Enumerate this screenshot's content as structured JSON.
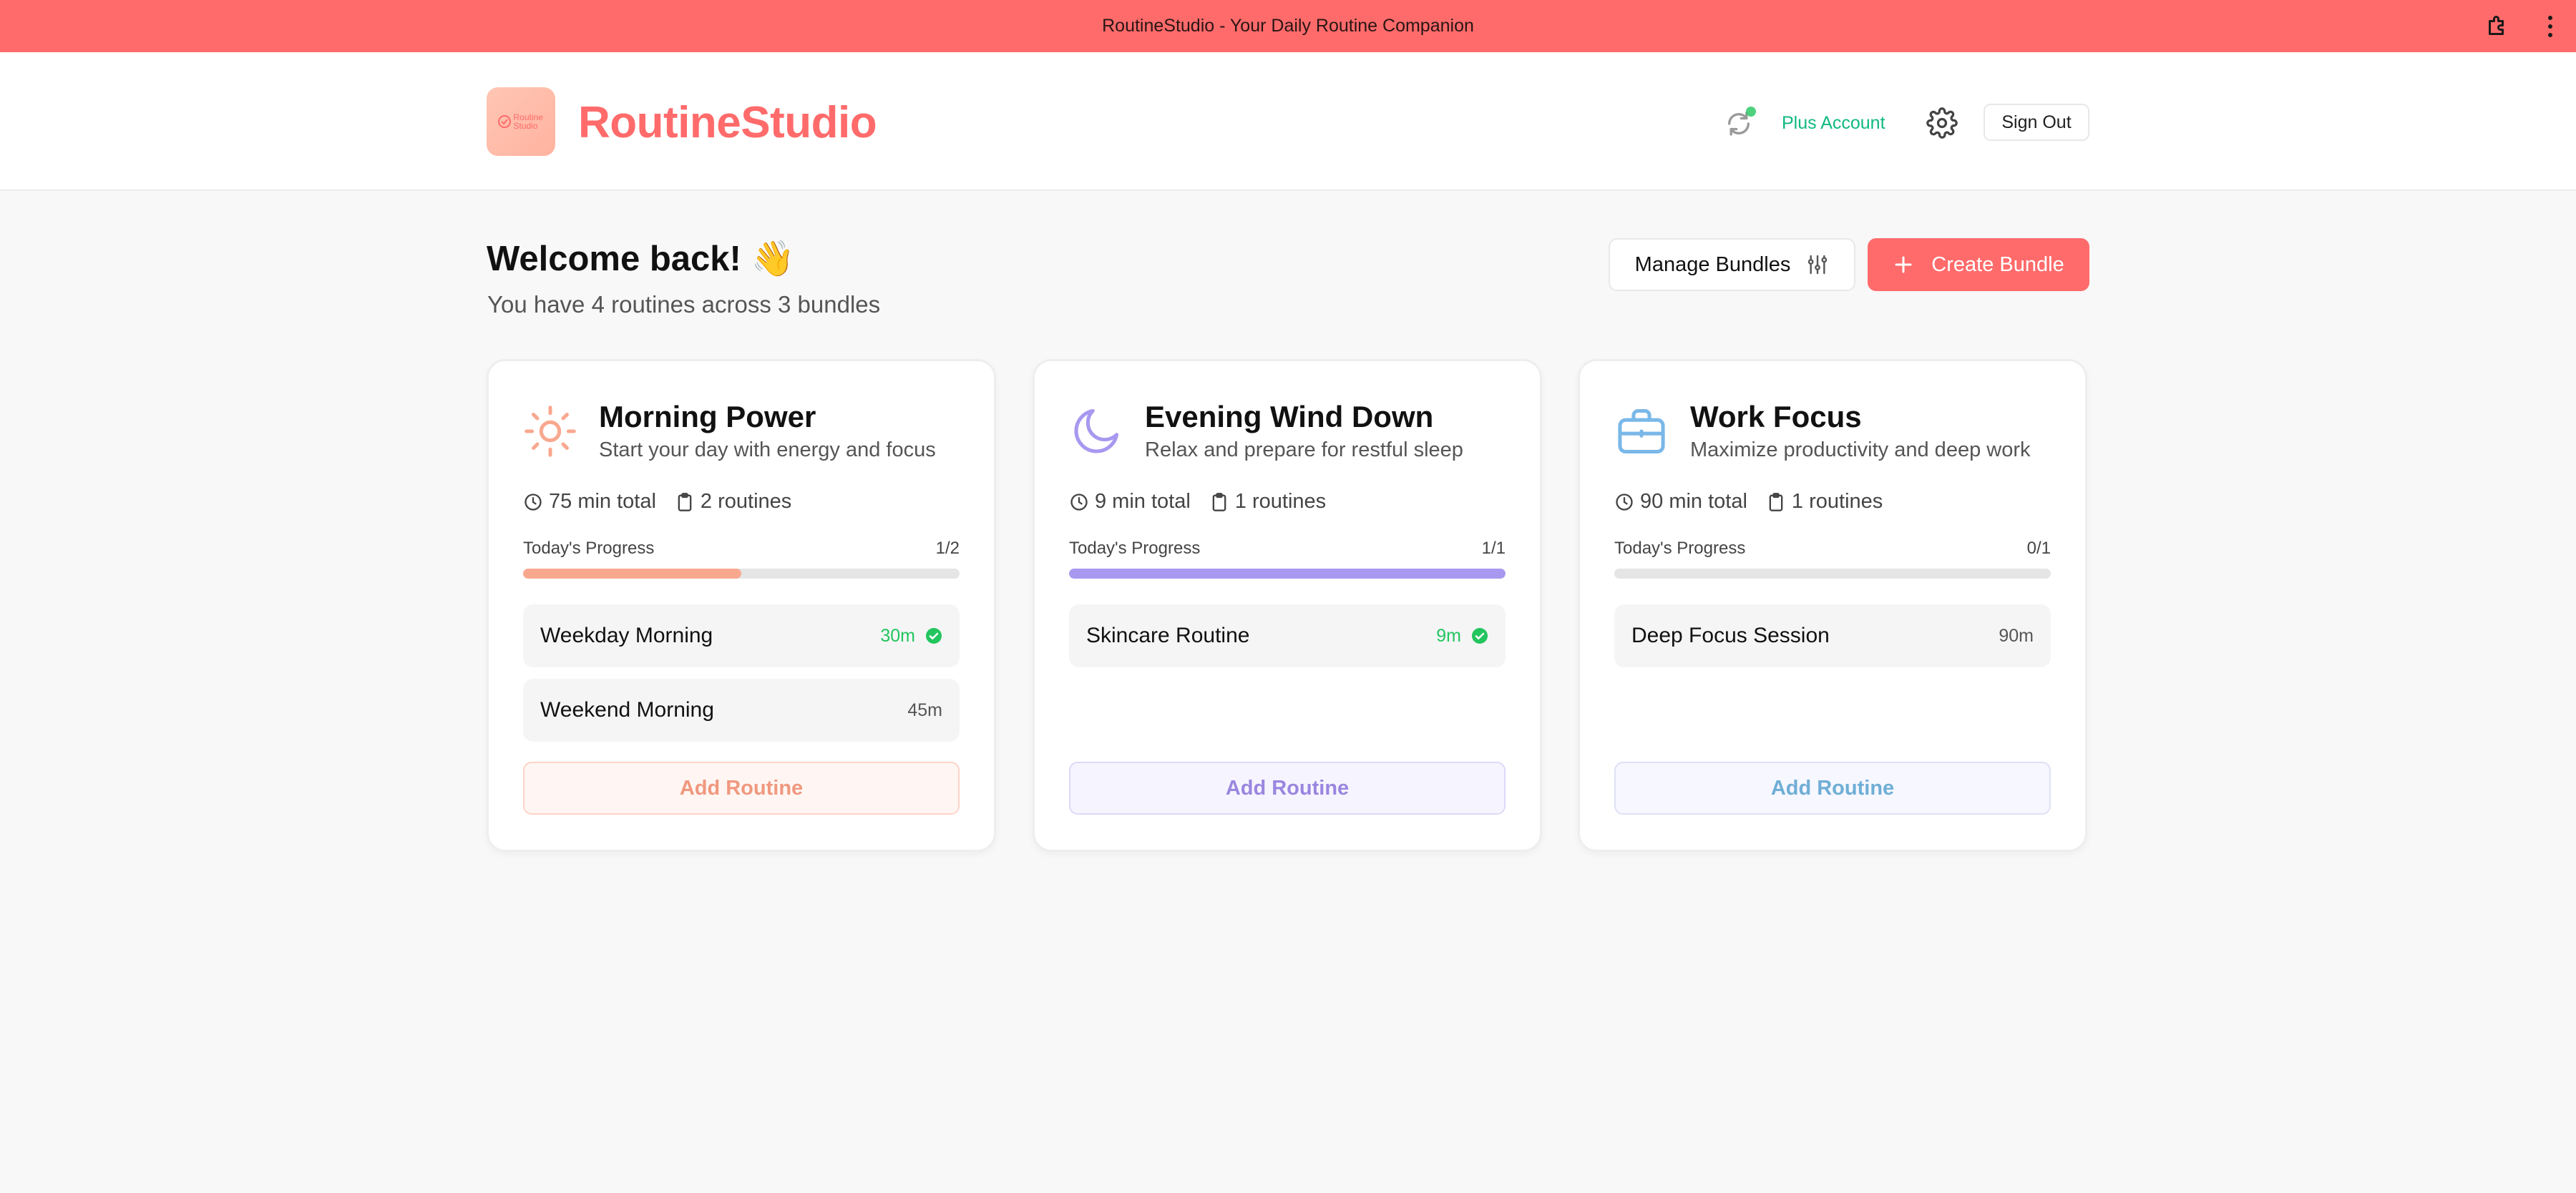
{
  "topbar": {
    "title": "RoutineStudio - Your Daily Routine Companion"
  },
  "header": {
    "brand": "RoutineStudio",
    "logo_text": "Routine Studio",
    "account_label": "Plus Account",
    "sign_out_label": "Sign Out"
  },
  "welcome": {
    "title": "Welcome back! 👋",
    "subtitle": "You have 4 routines across 3 bundles"
  },
  "actions": {
    "manage_label": "Manage Bundles",
    "create_label": "Create Bundle"
  },
  "bundles": [
    {
      "title": "Morning Power",
      "description": "Start your day with energy and focus",
      "icon": "sun-icon",
      "accent": "#f9a890",
      "total": "75 min total",
      "count": "2 routines",
      "progress_label": "Today's Progress",
      "progress_text": "1/2",
      "progress": 0.5,
      "routines": [
        {
          "name": "Weekday Morning",
          "time": "30m",
          "done": true
        },
        {
          "name": "Weekend Morning",
          "time": "45m",
          "done": false
        }
      ],
      "add_label": "Add Routine"
    },
    {
      "title": "Evening Wind Down",
      "description": "Relax and prepare for restful sleep",
      "icon": "moon-icon",
      "accent": "#a898f0",
      "total": "9 min total",
      "count": "1 routines",
      "progress_label": "Today's Progress",
      "progress_text": "1/1",
      "progress": 1.0,
      "routines": [
        {
          "name": "Skincare Routine",
          "time": "9m",
          "done": true
        }
      ],
      "add_label": "Add Routine"
    },
    {
      "title": "Work Focus",
      "description": "Maximize productivity and deep work",
      "icon": "briefcase-icon",
      "accent": "#7ab8e8",
      "total": "90 min total",
      "count": "1 routines",
      "progress_label": "Today's Progress",
      "progress_text": "0/1",
      "progress": 0.0,
      "routines": [
        {
          "name": "Deep Focus Session",
          "time": "90m",
          "done": false
        }
      ],
      "add_label": "Add Routine"
    }
  ],
  "colors": {
    "brand": "#ff6b6b",
    "success": "#22c55e",
    "plus_account": "#10b981"
  }
}
